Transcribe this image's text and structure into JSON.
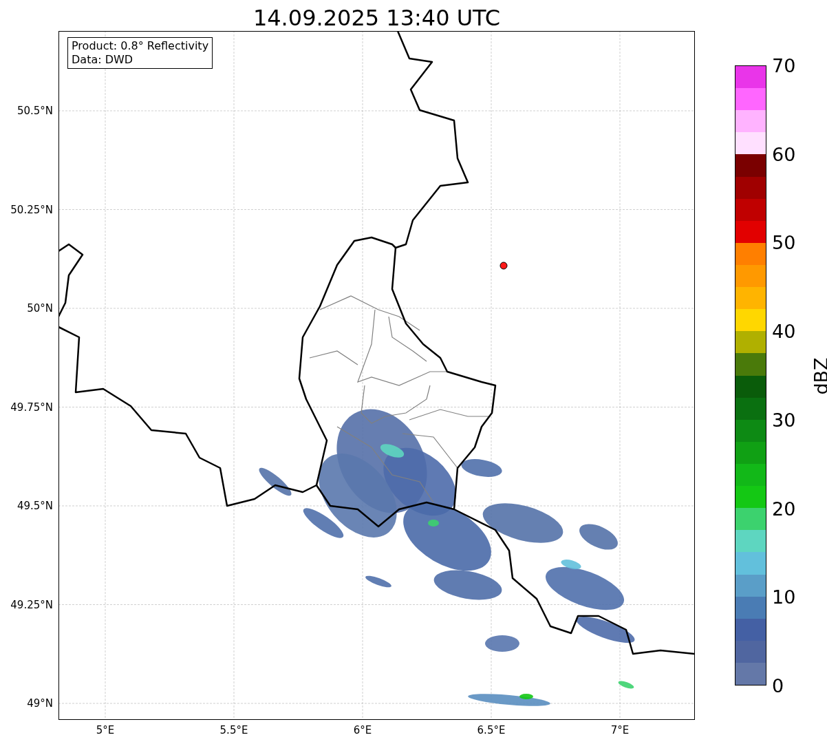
{
  "title": "14.09.2025 13:40 UTC",
  "info_box": [
    "Product: 0.8° Reflectivity",
    "Data: DWD"
  ],
  "map": {
    "yticks": [
      "50.5°N",
      "50.25°N",
      "50°N",
      "49.75°N",
      "49.5°N",
      "49.25°N",
      "49°N"
    ],
    "xticks": [
      "5°E",
      "5.5°E",
      "6°E",
      "6.5°E",
      "7°E"
    ]
  },
  "colorbar": {
    "label": "dBZ",
    "ticks": [
      "70",
      "60",
      "50",
      "40",
      "30",
      "20",
      "10",
      "0"
    ],
    "bands": [
      {
        "color": "#e935e9"
      },
      {
        "color": "#ff66ff"
      },
      {
        "color": "#ffb3ff"
      },
      {
        "color": "#ffe0ff"
      },
      {
        "color": "#7a0000"
      },
      {
        "color": "#a00000"
      },
      {
        "color": "#c00000"
      },
      {
        "color": "#e20000"
      },
      {
        "color": "#ff7f00"
      },
      {
        "color": "#ff9900"
      },
      {
        "color": "#ffb400"
      },
      {
        "color": "#ffd700"
      },
      {
        "color": "#b0b000"
      },
      {
        "color": "#4a7a0a"
      },
      {
        "color": "#0a5c0a"
      },
      {
        "color": "#0a7010"
      },
      {
        "color": "#0d8a14"
      },
      {
        "color": "#10a014"
      },
      {
        "color": "#12b818"
      },
      {
        "color": "#14c814"
      },
      {
        "color": "#3cd26e"
      },
      {
        "color": "#5ed6c0"
      },
      {
        "color": "#62c0dc"
      },
      {
        "color": "#5a9ec8"
      },
      {
        "color": "#4a7cb4"
      },
      {
        "color": "#4460a4"
      },
      {
        "color": "#5066a0"
      },
      {
        "color": "#6478a8"
      }
    ]
  }
}
